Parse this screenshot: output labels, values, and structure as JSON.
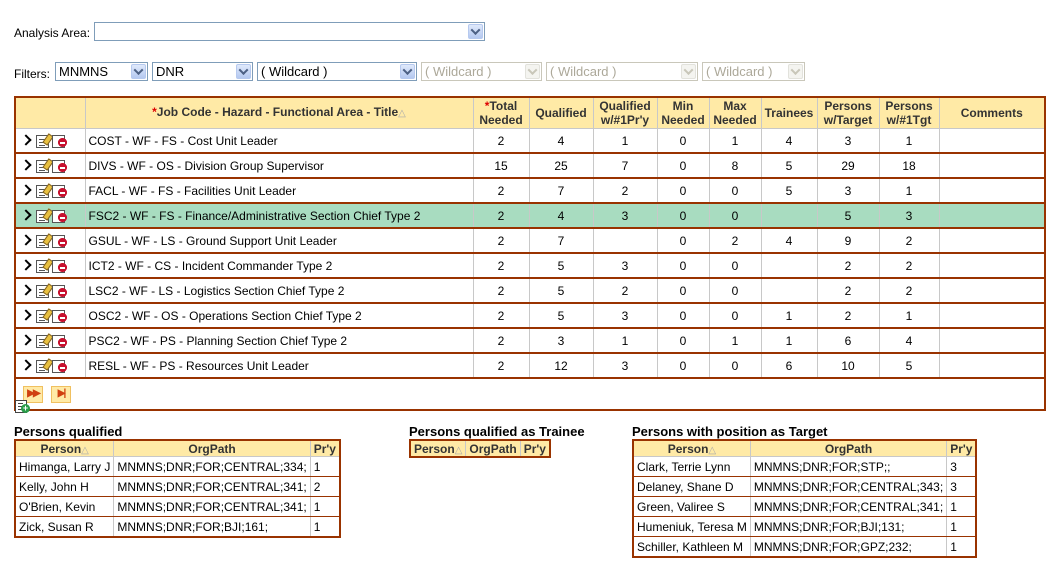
{
  "analysis_area": {
    "label": "Analysis Area:",
    "value": ""
  },
  "filters": {
    "label": "Filters:",
    "selects": [
      {
        "value": "MNMNS",
        "enabled": true
      },
      {
        "value": "DNR",
        "enabled": true
      },
      {
        "value": "( Wildcard )",
        "enabled": true
      },
      {
        "value": "( Wildcard )",
        "enabled": false
      },
      {
        "value": "( Wildcard )",
        "enabled": false
      },
      {
        "value": "( Wildcard )",
        "enabled": false
      }
    ]
  },
  "main_table": {
    "headers": {
      "title": "Job Code - Hazard - Functional Area - Title",
      "total_needed_1": "Total",
      "total_needed_2": "Needed",
      "qualified": "Qualified",
      "qualified_pry_1": "Qualified",
      "qualified_pry_2": "w/#1Pr'y",
      "min_needed_1": "Min",
      "min_needed_2": "Needed",
      "max_needed_1": "Max",
      "max_needed_2": "Needed",
      "trainees": "Trainees",
      "persons_target_1": "Persons",
      "persons_target_2": "w/Target",
      "persons_tgt1_1": "Persons",
      "persons_tgt1_2": "w/#1Tgt",
      "comments": "Comments",
      "required_mark": "*",
      "sort_mark": "△"
    },
    "rows": [
      {
        "title": "COST - WF - FS - Cost Unit Leader",
        "total": "2",
        "qualified": "4",
        "qual_pry": "1",
        "min": "0",
        "max": "1",
        "trainees": "4",
        "p_target": "3",
        "p_tgt1": "1",
        "comments": "",
        "selected": false
      },
      {
        "title": "DIVS - WF - OS - Division Group Supervisor",
        "total": "15",
        "qualified": "25",
        "qual_pry": "7",
        "min": "0",
        "max": "8",
        "trainees": "5",
        "p_target": "29",
        "p_tgt1": "18",
        "comments": "",
        "selected": false
      },
      {
        "title": "FACL - WF - FS - Facilities Unit Leader",
        "total": "2",
        "qualified": "7",
        "qual_pry": "2",
        "min": "0",
        "max": "0",
        "trainees": "5",
        "p_target": "3",
        "p_tgt1": "1",
        "comments": "",
        "selected": false
      },
      {
        "title": "FSC2 - WF - FS - Finance/Administrative Section Chief Type 2",
        "total": "2",
        "qualified": "4",
        "qual_pry": "3",
        "min": "0",
        "max": "0",
        "trainees": "",
        "p_target": "5",
        "p_tgt1": "3",
        "comments": "",
        "selected": true
      },
      {
        "title": "GSUL - WF - LS - Ground Support Unit Leader",
        "total": "2",
        "qualified": "7",
        "qual_pry": "",
        "min": "0",
        "max": "2",
        "trainees": "4",
        "p_target": "9",
        "p_tgt1": "2",
        "comments": "",
        "selected": false
      },
      {
        "title": "ICT2 - WF - CS - Incident Commander Type 2",
        "total": "2",
        "qualified": "5",
        "qual_pry": "3",
        "min": "0",
        "max": "0",
        "trainees": "",
        "p_target": "2",
        "p_tgt1": "2",
        "comments": "",
        "selected": false
      },
      {
        "title": "LSC2 - WF - LS - Logistics Section Chief Type 2",
        "total": "2",
        "qualified": "5",
        "qual_pry": "2",
        "min": "0",
        "max": "0",
        "trainees": "",
        "p_target": "2",
        "p_tgt1": "2",
        "comments": "",
        "selected": false
      },
      {
        "title": "OSC2 - WF - OS - Operations Section Chief Type 2",
        "total": "2",
        "qualified": "5",
        "qual_pry": "3",
        "min": "0",
        "max": "0",
        "trainees": "1",
        "p_target": "2",
        "p_tgt1": "1",
        "comments": "",
        "selected": false
      },
      {
        "title": "PSC2 - WF - PS - Planning Section Chief Type 2",
        "total": "2",
        "qualified": "3",
        "qual_pry": "1",
        "min": "0",
        "max": "1",
        "trainees": "1",
        "p_target": "6",
        "p_tgt1": "4",
        "comments": "",
        "selected": false
      },
      {
        "title": "RESL - WF - PS - Resources Unit Leader",
        "total": "2",
        "qualified": "12",
        "qual_pry": "3",
        "min": "0",
        "max": "0",
        "trainees": "6",
        "p_target": "10",
        "p_tgt1": "5",
        "comments": "",
        "selected": false
      }
    ],
    "pager": {
      "next_icon": "▶▶",
      "last_icon": "▶|"
    }
  },
  "persons_qualified": {
    "title": "Persons qualified",
    "headers": {
      "person": "Person",
      "orgpath": "OrgPath",
      "pry": "Pr'y",
      "sort_mark": "△"
    },
    "rows": [
      {
        "person": "Himanga, Larry J",
        "orgpath": "MNMNS;DNR;FOR;CENTRAL;334;",
        "pry": "1"
      },
      {
        "person": "Kelly, John H",
        "orgpath": "MNMNS;DNR;FOR;CENTRAL;341;",
        "pry": "2"
      },
      {
        "person": "O'Brien, Kevin",
        "orgpath": "MNMNS;DNR;FOR;CENTRAL;341;",
        "pry": "1"
      },
      {
        "person": "Zick, Susan R",
        "orgpath": "MNMNS;DNR;FOR;BJI;161;",
        "pry": "1"
      }
    ]
  },
  "persons_trainee": {
    "title": "Persons qualified as Trainee",
    "headers": {
      "person": "Person",
      "orgpath": "OrgPath",
      "pry": "Pr'y",
      "sort_mark": "△"
    },
    "rows": []
  },
  "persons_target": {
    "title": "Persons with position as Target",
    "headers": {
      "person": "Person",
      "orgpath": "OrgPath",
      "pry": "Pr'y",
      "sort_mark": "△"
    },
    "rows": [
      {
        "person": "Clark, Terrie Lynn",
        "orgpath": "MNMNS;DNR;FOR;STP;;",
        "pry": "3"
      },
      {
        "person": "Delaney, Shane D",
        "orgpath": "MNMNS;DNR;FOR;CENTRAL;343;",
        "pry": "3"
      },
      {
        "person": "Green, Valiree S",
        "orgpath": "MNMNS;DNR;FOR;CENTRAL;341;",
        "pry": "1"
      },
      {
        "person": "Humeniuk, Teresa M",
        "orgpath": "MNMNS;DNR;FOR;BJI;131;",
        "pry": "1"
      },
      {
        "person": "Schiller, Kathleen M",
        "orgpath": "MNMNS;DNR;FOR;GPZ;232;",
        "pry": "1"
      }
    ]
  },
  "colors": {
    "border": "#993300",
    "header_bg": "#ffeaa6",
    "selected_row": "#a8dcc0"
  }
}
